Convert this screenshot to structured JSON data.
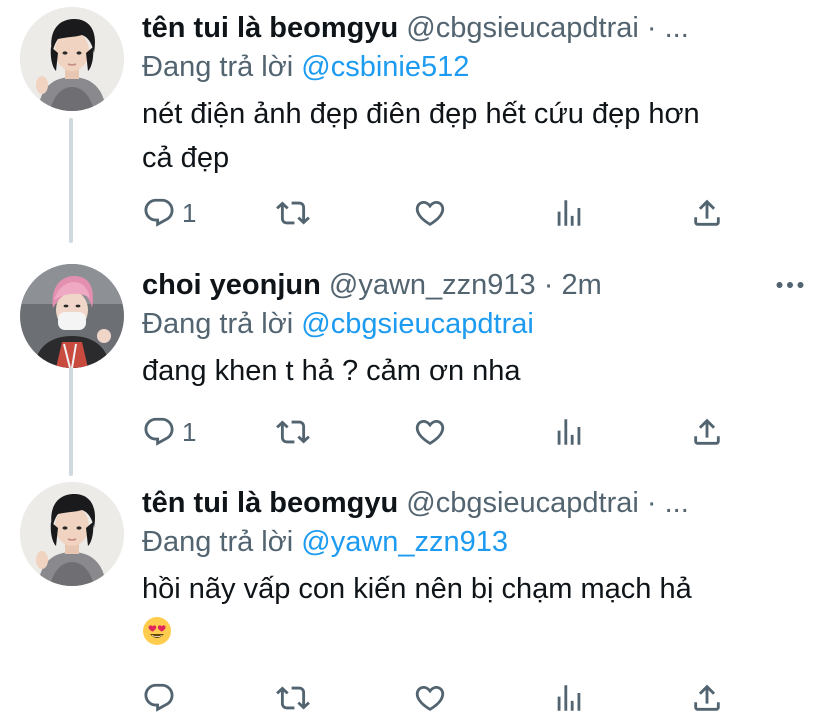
{
  "tweets": [
    {
      "display_name": "tên tui là beomgyu",
      "handle": "@cbgsieucapdtrai",
      "separator": "·",
      "time": "...",
      "time_suffix": "",
      "reply_prefix": "Đang trả lời",
      "reply_to": "@csbinie512",
      "text_line1": "nét điện ảnh đẹp điên đẹp hết cứu đẹp hơn",
      "text_line2": "cả đẹp",
      "reply_count": "1",
      "avatar_icon": "profile-photo-beomgyu"
    },
    {
      "display_name": "choi yeonjun",
      "handle": "@yawn_zzn913",
      "separator": "·",
      "time": "2m",
      "reply_prefix": "Đang trả lời",
      "reply_to": "@cbgsieucapdtrai",
      "text_line1": "đang khen t hả ? cảm ơn nha",
      "reply_count": "1",
      "avatar_icon": "profile-photo-yeonjun"
    },
    {
      "display_name": "tên tui là beomgyu",
      "handle": "@cbgsieucapdtrai",
      "separator": "·",
      "time": "...",
      "reply_prefix": "Đang trả lời",
      "reply_to": "@yawn_zzn913",
      "text_line1": "hồi nãy vấp con kiến nên bị chạm mạch hả",
      "emoji": "heart-eyes-emoji",
      "reply_count": "",
      "avatar_icon": "profile-photo-beomgyu"
    }
  ],
  "icons": {
    "reply": "reply-icon",
    "retweet": "retweet-icon",
    "like": "heart-icon",
    "views": "analytics-icon",
    "share": "share-icon",
    "more": "more-options-icon"
  },
  "colors": {
    "text": "#0f1419",
    "secondary": "#536471",
    "link": "#1d9bf0",
    "thread_line": "#cfd9de"
  }
}
